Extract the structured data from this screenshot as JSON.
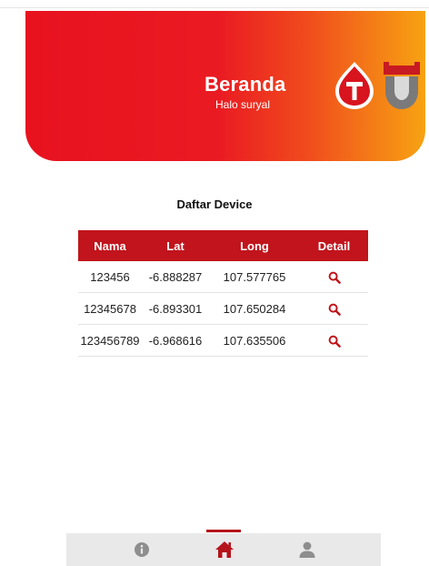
{
  "header": {
    "title": "Beranda",
    "subtitle": "Halo suryal"
  },
  "devices": {
    "title": "Daftar Device",
    "columns": [
      "Nama",
      "Lat",
      "Long",
      "Detail"
    ],
    "rows": [
      {
        "nama": "123456",
        "lat": "-6.888287",
        "long": "107.577765",
        "detail_icon": "search-icon"
      },
      {
        "nama": "12345678",
        "lat": "-6.893301",
        "long": "107.650284",
        "detail_icon": "search-icon"
      },
      {
        "nama": "123456789",
        "lat": "-6.968616",
        "long": "107.635506",
        "detail_icon": "search-icon"
      }
    ]
  },
  "nav": {
    "items": [
      {
        "icon": "info-icon"
      },
      {
        "icon": "home-icon",
        "active": true
      },
      {
        "icon": "user-icon"
      }
    ]
  },
  "colors": {
    "primary": "#c1141c",
    "header_start": "#e8121f",
    "header_end": "#f7a312",
    "nav_bg": "#e9e9e9"
  }
}
